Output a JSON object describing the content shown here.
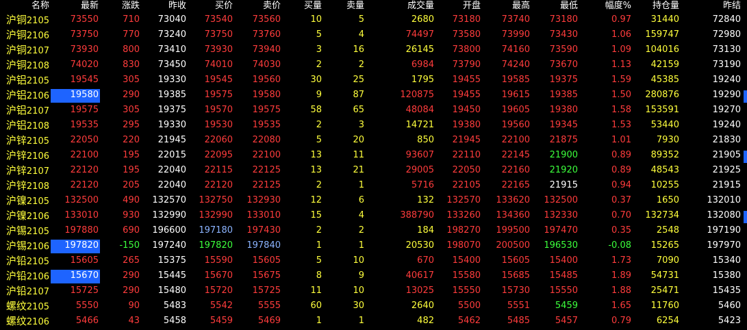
{
  "headers": {
    "name": "名称",
    "last": "最新",
    "change": "涨跌",
    "prev_close": "昨收",
    "bid": "买价",
    "ask": "卖价",
    "bid_vol": "买量",
    "ask_vol": "卖量",
    "volume": "成交量",
    "open": "开盘",
    "high": "最高",
    "low": "最低",
    "pct": "幅度%",
    "open_interest": "持仓量",
    "prev_settle": "昨结"
  },
  "colors": {
    "background": "#000000",
    "up": "#ff3c3c",
    "down": "#3cff3c",
    "neutral": "#ffffff",
    "name_yellow": "#ffff3c",
    "selection": "#1e64ff"
  },
  "rows": [
    {
      "sym": "沪铜",
      "code": "2105",
      "last": "73550",
      "chg": "710",
      "prev": "73040",
      "bid": "73540",
      "ask": "73560",
      "bidv": "10",
      "askv": "5",
      "vol": "2680",
      "open": "73180",
      "high": "73740",
      "low": "73180",
      "pct": "0.97",
      "oi": "31440",
      "settle": "72840"
    },
    {
      "sym": "沪铜",
      "code": "2106",
      "last": "73750",
      "chg": "770",
      "prev": "73240",
      "bid": "73750",
      "ask": "73760",
      "bidv": "5",
      "askv": "4",
      "vol": "74497",
      "open": "73580",
      "high": "73990",
      "low": "73430",
      "pct": "1.06",
      "oi": "159747",
      "settle": "72980"
    },
    {
      "sym": "沪铜",
      "code": "2107",
      "last": "73930",
      "chg": "800",
      "prev": "73410",
      "bid": "73930",
      "ask": "73940",
      "bidv": "3",
      "askv": "16",
      "vol": "26145",
      "open": "73800",
      "high": "74160",
      "low": "73590",
      "pct": "1.09",
      "oi": "104016",
      "settle": "73130"
    },
    {
      "sym": "沪铜",
      "code": "2108",
      "last": "74020",
      "chg": "830",
      "prev": "73450",
      "bid": "74010",
      "ask": "74030",
      "bidv": "2",
      "askv": "2",
      "vol": "6984",
      "open": "73790",
      "high": "74240",
      "low": "73670",
      "pct": "1.13",
      "oi": "42159",
      "settle": "73190"
    },
    {
      "sym": "沪铝",
      "code": "2105",
      "last": "19545",
      "chg": "305",
      "prev": "19330",
      "bid": "19545",
      "ask": "19560",
      "bidv": "30",
      "askv": "25",
      "vol": "1795",
      "open": "19455",
      "high": "19585",
      "low": "19375",
      "pct": "1.59",
      "oi": "45385",
      "settle": "19240"
    },
    {
      "sym": "沪铝",
      "code": "2106",
      "last": "19580",
      "chg": "290",
      "prev": "19385",
      "bid": "19575",
      "ask": "19580",
      "bidv": "9",
      "askv": "87",
      "vol": "120875",
      "open": "19455",
      "high": "19615",
      "low": "19385",
      "pct": "1.50",
      "oi": "280876",
      "settle": "19290",
      "selected": true
    },
    {
      "sym": "沪铝",
      "code": "2107",
      "last": "19575",
      "chg": "305",
      "prev": "19375",
      "bid": "19570",
      "ask": "19575",
      "bidv": "58",
      "askv": "65",
      "vol": "48084",
      "open": "19450",
      "high": "19605",
      "low": "19380",
      "pct": "1.58",
      "oi": "153591",
      "settle": "19270"
    },
    {
      "sym": "沪铝",
      "code": "2108",
      "last": "19535",
      "chg": "295",
      "prev": "19330",
      "bid": "19530",
      "ask": "19535",
      "bidv": "2",
      "askv": "3",
      "vol": "14721",
      "open": "19380",
      "high": "19560",
      "low": "19345",
      "pct": "1.53",
      "oi": "53440",
      "settle": "19240"
    },
    {
      "sym": "沪锌",
      "code": "2105",
      "last": "22050",
      "chg": "220",
      "prev": "21945",
      "bid": "22060",
      "ask": "22080",
      "bidv": "5",
      "askv": "20",
      "vol": "850",
      "open": "21945",
      "high": "22100",
      "low": "21875",
      "pct": "1.01",
      "oi": "7930",
      "settle": "21830"
    },
    {
      "sym": "沪锌",
      "code": "2106",
      "last": "22100",
      "chg": "195",
      "prev": "22015",
      "bid": "22095",
      "ask": "22100",
      "bidv": "13",
      "askv": "11",
      "vol": "93607",
      "open": "22110",
      "high": "22145",
      "low": "21900",
      "pct": "0.89",
      "oi": "89352",
      "settle": "21905"
    },
    {
      "sym": "沪锌",
      "code": "2107",
      "last": "22120",
      "chg": "195",
      "prev": "22040",
      "bid": "22115",
      "ask": "22125",
      "bidv": "13",
      "askv": "21",
      "vol": "29005",
      "open": "22050",
      "high": "22160",
      "low": "21920",
      "pct": "0.89",
      "oi": "48543",
      "settle": "21925"
    },
    {
      "sym": "沪锌",
      "code": "2108",
      "last": "22120",
      "chg": "205",
      "prev": "22040",
      "bid": "22120",
      "ask": "22125",
      "bidv": "2",
      "askv": "1",
      "vol": "5716",
      "open": "22105",
      "high": "22165",
      "low": "21915",
      "pct": "0.94",
      "oi": "10255",
      "settle": "21915"
    },
    {
      "sym": "沪镍",
      "code": "2105",
      "last": "132500",
      "chg": "490",
      "prev": "132570",
      "bid": "132750",
      "ask": "132930",
      "bidv": "12",
      "askv": "6",
      "vol": "132",
      "open": "132570",
      "high": "133620",
      "low": "132500",
      "pct": "0.37",
      "oi": "1650",
      "settle": "132010"
    },
    {
      "sym": "沪镍",
      "code": "2106",
      "last": "133010",
      "chg": "930",
      "prev": "132990",
      "bid": "132990",
      "ask": "133010",
      "bidv": "15",
      "askv": "4",
      "vol": "388790",
      "open": "133260",
      "high": "134360",
      "low": "132330",
      "pct": "0.70",
      "oi": "132734",
      "settle": "132080"
    },
    {
      "sym": "沪锡",
      "code": "2105",
      "last": "197880",
      "chg": "690",
      "prev": "196600",
      "bid": "197180",
      "ask": "197430",
      "bidv": "2",
      "askv": "2",
      "vol": "184",
      "open": "198270",
      "high": "199500",
      "low": "197470",
      "pct": "0.35",
      "oi": "2548",
      "settle": "197190"
    },
    {
      "sym": "沪锡",
      "code": "2106",
      "last": "197820",
      "chg": "-150",
      "prev": "197240",
      "bid": "197820",
      "ask": "197840",
      "bidv": "1",
      "askv": "1",
      "vol": "20530",
      "open": "198070",
      "high": "200500",
      "low": "196530",
      "pct": "-0.08",
      "oi": "15265",
      "settle": "197970",
      "selected": true
    },
    {
      "sym": "沪铅",
      "code": "2105",
      "last": "15605",
      "chg": "265",
      "prev": "15375",
      "bid": "15590",
      "ask": "15605",
      "bidv": "5",
      "askv": "10",
      "vol": "670",
      "open": "15400",
      "high": "15605",
      "low": "15400",
      "pct": "1.73",
      "oi": "7090",
      "settle": "15340"
    },
    {
      "sym": "沪铅",
      "code": "2106",
      "last": "15670",
      "chg": "290",
      "prev": "15445",
      "bid": "15670",
      "ask": "15675",
      "bidv": "8",
      "askv": "9",
      "vol": "40617",
      "open": "15580",
      "high": "15685",
      "low": "15485",
      "pct": "1.89",
      "oi": "54731",
      "settle": "15380",
      "selected": true
    },
    {
      "sym": "沪铅",
      "code": "2107",
      "last": "15725",
      "chg": "290",
      "prev": "15480",
      "bid": "15720",
      "ask": "15725",
      "bidv": "11",
      "askv": "10",
      "vol": "13025",
      "open": "15550",
      "high": "15730",
      "low": "15550",
      "pct": "1.88",
      "oi": "25471",
      "settle": "15435"
    },
    {
      "sym": "螺纹",
      "code": "2105",
      "last": "5550",
      "chg": "90",
      "prev": "5483",
      "bid": "5542",
      "ask": "5555",
      "bidv": "60",
      "askv": "30",
      "vol": "2640",
      "open": "5500",
      "high": "5551",
      "low": "5459",
      "pct": "1.65",
      "oi": "11760",
      "settle": "5460"
    },
    {
      "sym": "螺纹",
      "code": "2106",
      "last": "5466",
      "chg": "43",
      "prev": "5458",
      "bid": "5459",
      "ask": "5469",
      "bidv": "1",
      "askv": "1",
      "vol": "482",
      "open": "5462",
      "high": "5485",
      "low": "5457",
      "pct": "0.79",
      "oi": "6254",
      "settle": "5423"
    }
  ]
}
